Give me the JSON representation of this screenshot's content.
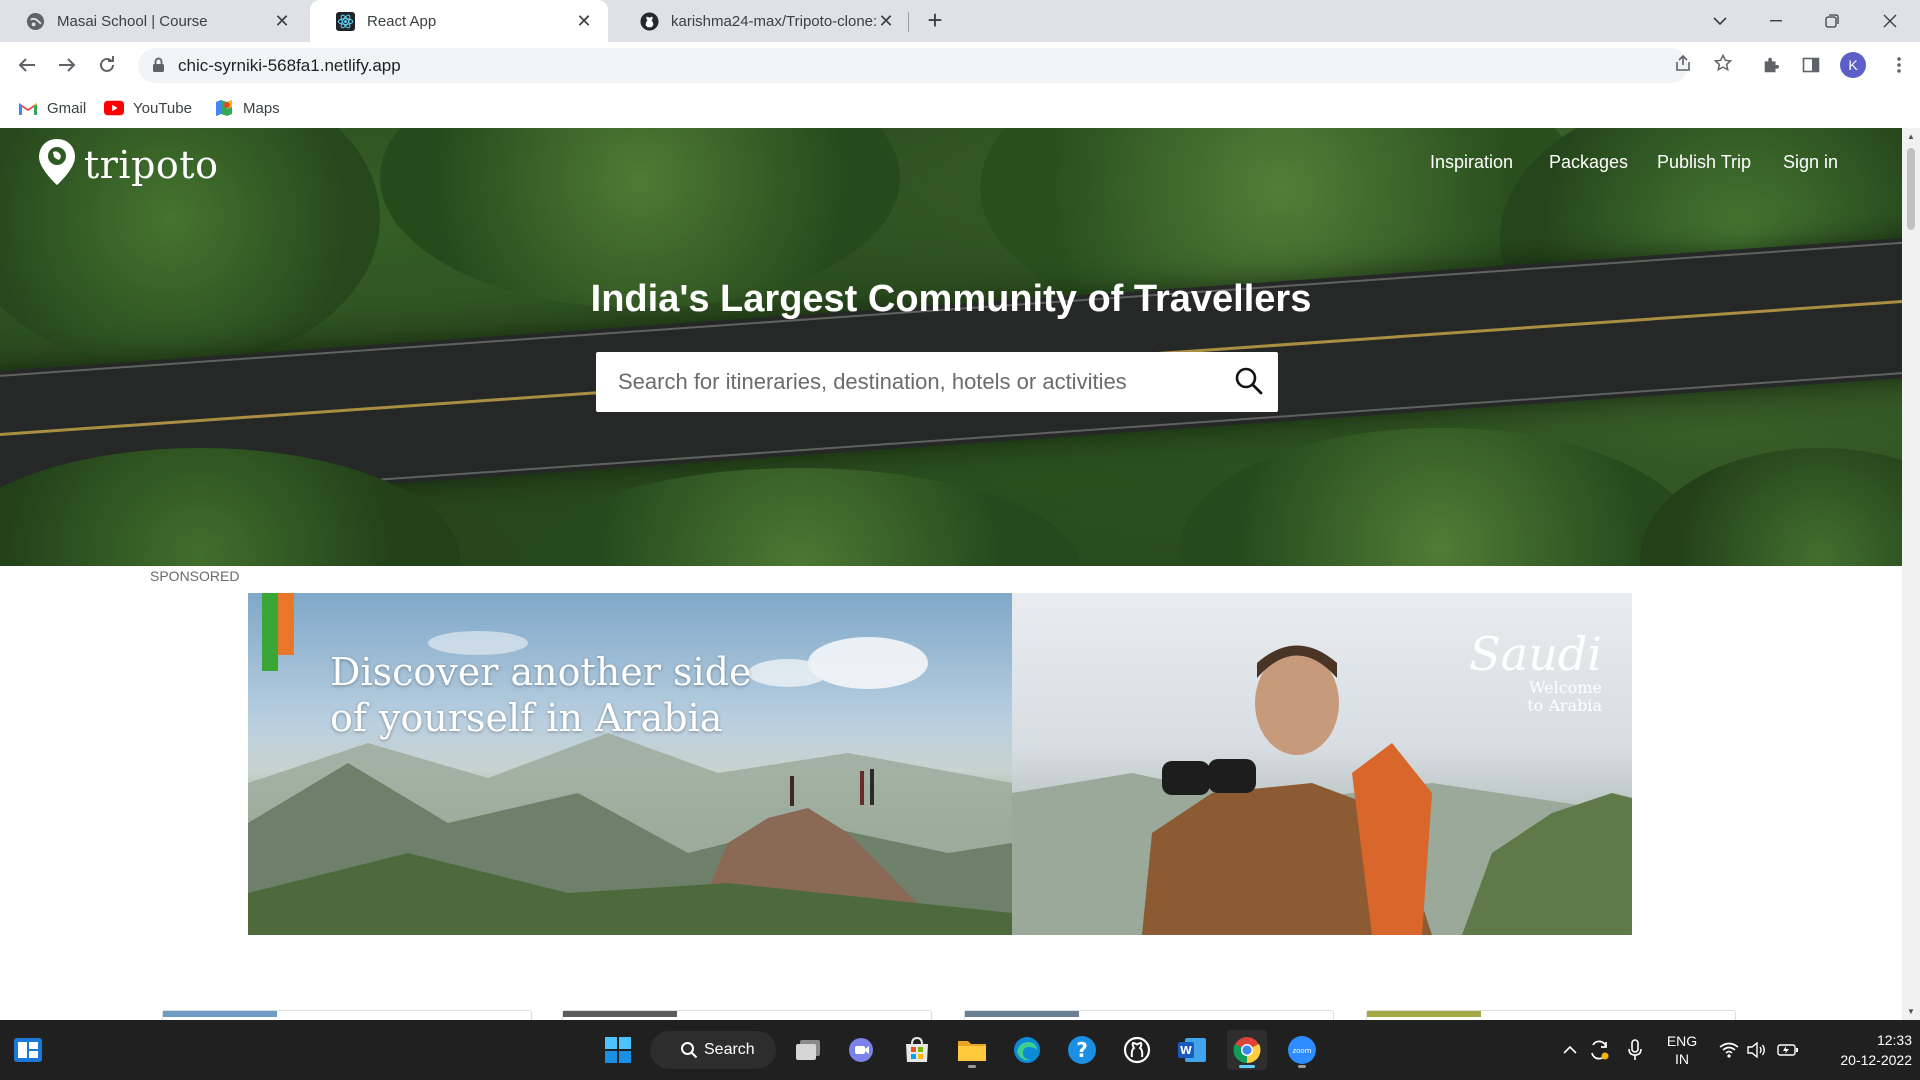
{
  "browser": {
    "tabs": [
      {
        "title": "Masai School | Course",
        "icon": "masai-globe-icon"
      },
      {
        "title": "React App",
        "icon": "react-icon",
        "active": true
      },
      {
        "title": "karishma24-max/Tripoto-clone: T",
        "icon": "github-icon"
      }
    ],
    "url": "chic-syrniki-568fa1.netlify.app",
    "profile_initial": "K",
    "bookmarks": [
      {
        "label": "Gmail",
        "icon": "gmail-icon"
      },
      {
        "label": "YouTube",
        "icon": "youtube-icon"
      },
      {
        "label": "Maps",
        "icon": "maps-icon"
      }
    ]
  },
  "site": {
    "logo_text": "tripoto",
    "nav": [
      "Inspiration",
      "Packages",
      "Publish Trip",
      "Sign in"
    ],
    "hero_title": "India's Largest Community of Travellers",
    "search_placeholder": "Search for itineraries, destination, hotels or activities",
    "sponsored_label": "SPONSORED",
    "ad": {
      "headline_line1": "Discover another side",
      "headline_line2": "of yourself in Arabia",
      "brand": "Saudi",
      "tagline_line1": "Welcome",
      "tagline_line2": "to Arabia"
    }
  },
  "taskbar": {
    "search_label": "Search",
    "lang_line1": "ENG",
    "lang_line2": "IN",
    "time": "12:33",
    "date": "20-12-2022"
  },
  "colors": {
    "tab_strip": "#dee1e6",
    "taskbar": "#202020",
    "profile": "#5b5fc7"
  }
}
